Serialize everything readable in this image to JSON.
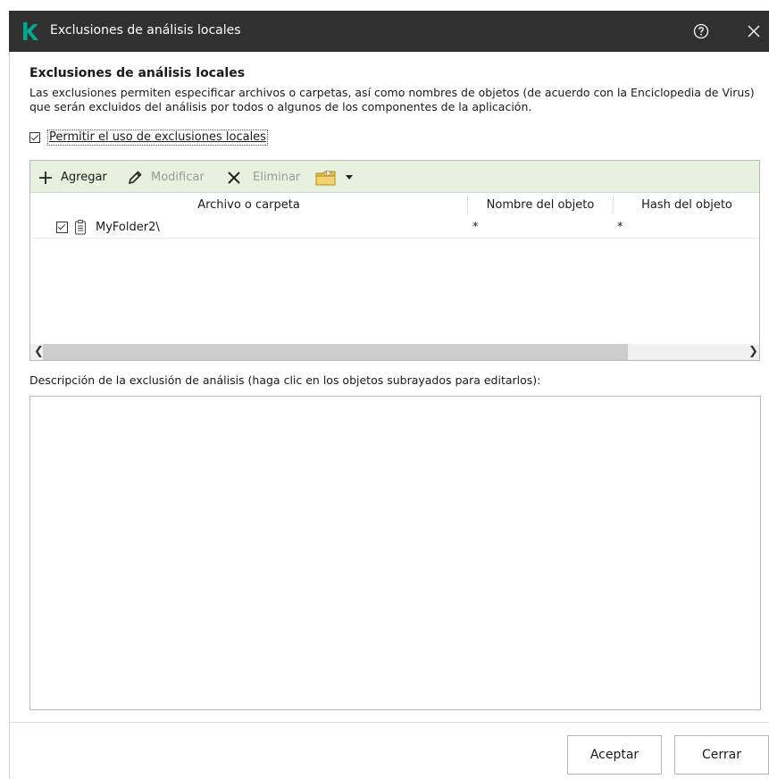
{
  "window": {
    "title": "Exclusiones de análisis locales",
    "brand_color": "#00a88e",
    "titlebar_color": "#303030",
    "icons": {
      "logo": "kaspersky-logo",
      "help": "help-circle-icon",
      "close": "close-icon"
    }
  },
  "main": {
    "heading": "Exclusiones de análisis locales",
    "description": "Las exclusiones permiten especificar archivos o carpetas, así como nombres de objetos (de acuerdo con la Enciclopedia de Virus) que serán excluidos del análisis por todos o algunos de los componentes de la aplicación.",
    "allow_checkbox": {
      "label": "Permitir el uso de exclusiones locales",
      "checked": true
    }
  },
  "toolbar": {
    "add_label": "Agregar",
    "modify_label": "Modificar",
    "delete_label": "Eliminar",
    "toolbar_color": "#e6f1de"
  },
  "table": {
    "columns": [
      "Archivo o carpeta",
      "Nombre del objeto",
      "Hash del objeto"
    ],
    "rows": [
      {
        "checked": true,
        "path": "MyFolder2\\",
        "object_name": "*",
        "object_hash": "*"
      }
    ]
  },
  "details": {
    "label": "Descripción de la exclusión de análisis (haga clic en los objetos subrayados para editarlos):"
  },
  "footer": {
    "ok_label": "Aceptar",
    "close_label": "Cerrar"
  }
}
